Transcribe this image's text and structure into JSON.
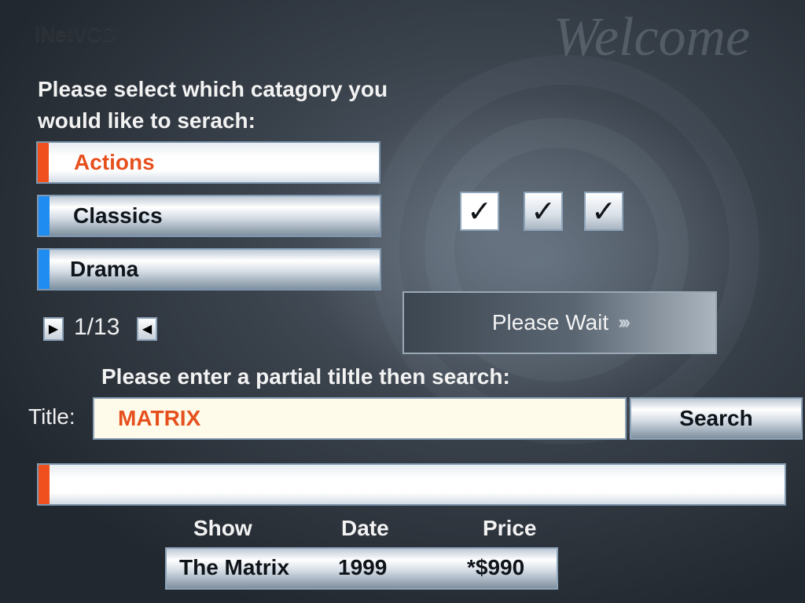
{
  "app": {
    "name": "INetVCD",
    "welcome": "Welcome"
  },
  "category": {
    "prompt_line1": "Please select which catagory you",
    "prompt_line2": "would like to serach:",
    "items": [
      {
        "label": "Actions",
        "selected": true,
        "accent": "#f0501e"
      },
      {
        "label": "Classics",
        "selected": false,
        "accent": "#1e8cf0"
      },
      {
        "label": "Drama",
        "selected": false,
        "accent": "#1e8cf0"
      }
    ],
    "pager": {
      "text": "1/13"
    }
  },
  "checkboxes": [
    {
      "icon": "checkmark-icon",
      "glyph": "✓"
    },
    {
      "icon": "checkmark-icon",
      "glyph": "✓"
    },
    {
      "icon": "checkmark-icon",
      "glyph": "✓"
    }
  ],
  "status": {
    "label": "Please Wait",
    "arrows": "›››"
  },
  "search": {
    "prompt": "Please enter a partial tiltle then search:",
    "title_label": "Title:",
    "title_value": "MATRIX",
    "button_label": "Search"
  },
  "progress": {
    "value": 0,
    "accent": "#f0501e"
  },
  "results": {
    "headers": {
      "show": "Show",
      "date": "Date",
      "price": "Price"
    },
    "rows": [
      {
        "show": "The Matrix",
        "date": "1999",
        "price": "*$990"
      }
    ]
  }
}
